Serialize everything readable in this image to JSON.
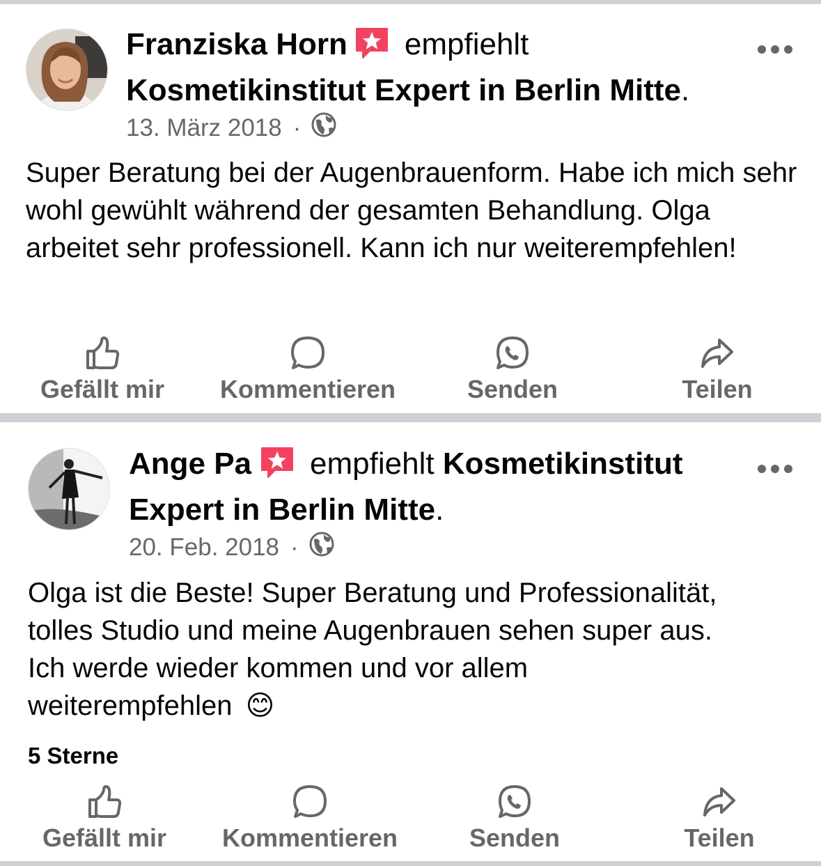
{
  "posts": [
    {
      "author": "Franziska Horn",
      "verb": "empfiehlt",
      "page": "Kosmetikinstitut Expert in Berlin Mitte",
      "date": "13. März 2018",
      "audience_icon": "globe-icon",
      "text": "Super Beratung bei der Augenbrauenform. Habe ich mich sehr wohl gewühlt während der gesamten Behandlung. Olga arbeitet sehr professionell. Kann ich nur weiterempfehlen!"
    },
    {
      "author": "Ange Pa",
      "verb": "empfiehlt",
      "page": "Kosmetikinstitut Expert in Berlin Mitte",
      "date": "20. Feb. 2018",
      "audience_icon": "globe-icon",
      "text": "Olga ist die Beste! Super Beratung und Professionalität, tolles Studio und meine Augenbrauen sehen super aus. Ich werde wieder kommen und vor allem weiterempfehlen",
      "emoji": "😊",
      "rating": "5 Sterne"
    }
  ],
  "actions": {
    "like": "Gefällt mir",
    "comment": "Kommentieren",
    "send": "Senden",
    "share": "Teilen"
  },
  "punct": ".",
  "dot": "·",
  "colors": {
    "recommend_badge": "#f3425f",
    "secondary_text": "#65676b",
    "divider": "#cdd0d4"
  }
}
